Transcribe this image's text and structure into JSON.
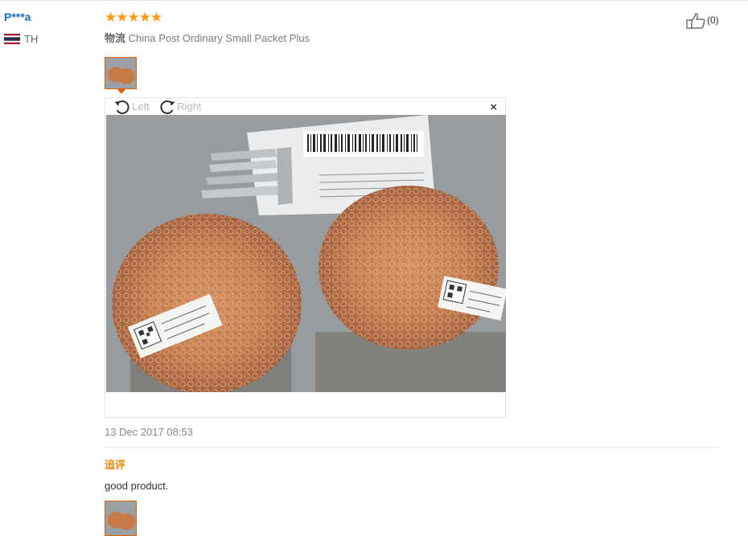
{
  "review": {
    "user_name": "P***a",
    "country_code": "TH",
    "stars": "★★★★★",
    "logistics_label": "物流",
    "logistics_value": "China Post Ordinary Small Packet Plus",
    "like_count": "(0)",
    "date": "13 Dec 2017 08:53"
  },
  "viewer": {
    "rotate_left_label": "Left",
    "rotate_right_label": "Right",
    "close_glyph": "×"
  },
  "followup": {
    "title": "追评",
    "text": "good product."
  },
  "colors": {
    "accent_orange": "#e06000",
    "star_color": "#ff9a0e",
    "username_blue": "#1a6fc9",
    "followup_orange": "#e88a00"
  }
}
